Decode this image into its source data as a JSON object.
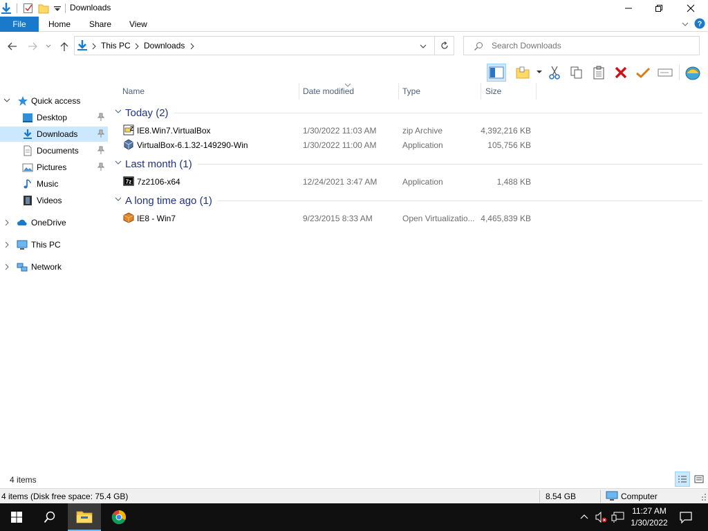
{
  "window": {
    "title": "Downloads"
  },
  "ribbon": {
    "tabs": [
      "File",
      "Home",
      "Share",
      "View"
    ]
  },
  "address": {
    "crumbs": [
      "This PC",
      "Downloads"
    ],
    "search_placeholder": "Search Downloads"
  },
  "nav": {
    "quick_access": "Quick access",
    "items": [
      {
        "label": "Desktop",
        "icon": "desktop-icon",
        "pinned": true
      },
      {
        "label": "Downloads",
        "icon": "downloads-icon",
        "pinned": true,
        "selected": true
      },
      {
        "label": "Documents",
        "icon": "documents-icon",
        "pinned": true
      },
      {
        "label": "Pictures",
        "icon": "pictures-icon",
        "pinned": true
      },
      {
        "label": "Music",
        "icon": "music-icon"
      },
      {
        "label": "Videos",
        "icon": "videos-icon"
      }
    ],
    "roots": [
      "OneDrive",
      "This PC",
      "Network"
    ]
  },
  "columns": {
    "name": "Name",
    "date": "Date modified",
    "type": "Type",
    "size": "Size"
  },
  "groups": [
    {
      "label": "Today (2)",
      "files": [
        {
          "name": "IE8.Win7.VirtualBox",
          "date": "1/30/2022 11:03 AM",
          "type": "zip Archive",
          "size": "4,392,216 KB",
          "icon": "zip-archive-icon"
        },
        {
          "name": "VirtualBox-6.1.32-149290-Win",
          "date": "1/30/2022 11:00 AM",
          "type": "Application",
          "size": "105,756 KB",
          "icon": "virtualbox-icon"
        }
      ]
    },
    {
      "label": "Last month (1)",
      "files": [
        {
          "name": "7z2106-x64",
          "date": "12/24/2021 3:47 AM",
          "type": "Application",
          "size": "1,488 KB",
          "icon": "7zip-icon"
        }
      ]
    },
    {
      "label": "A long time ago (1)",
      "files": [
        {
          "name": "IE8 - Win7",
          "date": "9/23/2015 8:33 AM",
          "type": "Open Virtualizatio...",
          "size": "4,465,839 KB",
          "icon": "ova-package-icon"
        }
      ]
    }
  ],
  "status": {
    "item_count": "4 items",
    "details": "4 items (Disk free space: 75.4 GB)",
    "selection_size": "8.54 GB",
    "location": "Computer"
  },
  "taskbar": {
    "time": "11:27 AM",
    "date": "1/30/2022"
  },
  "colors": {
    "accent": "#1979ca",
    "selection": "#cce8ff",
    "group_header": "#1e3287"
  }
}
